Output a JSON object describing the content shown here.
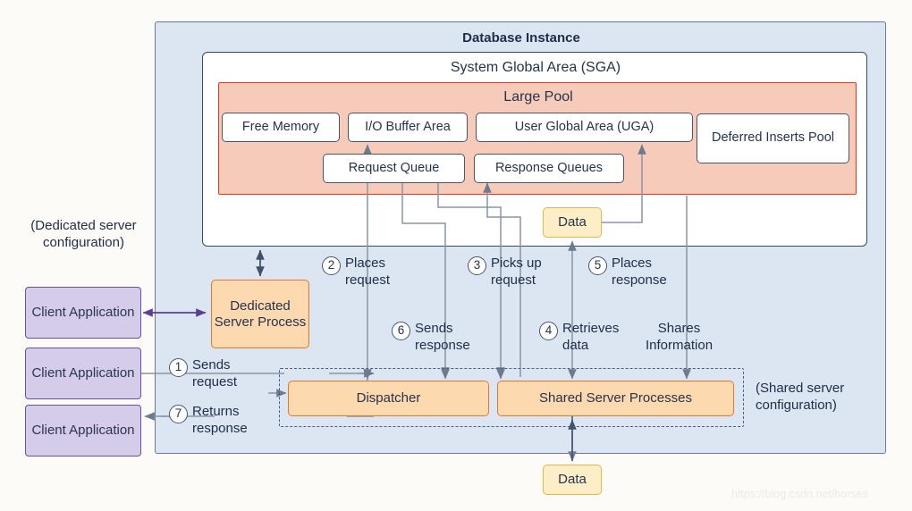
{
  "diagram": {
    "title": "Database Instance",
    "sga": {
      "title": "System Global Area (SGA)"
    },
    "large_pool": {
      "title": "Large Pool",
      "components": [
        {
          "id": "free-memory",
          "label": "Free Memory"
        },
        {
          "id": "io-buffer",
          "label": "I/O Buffer Area"
        },
        {
          "id": "uga",
          "label": "User Global Area (UGA)"
        },
        {
          "id": "deferred-inserts",
          "label": "Deferred Inserts Pool"
        },
        {
          "id": "request-queue",
          "label": "Request Queue"
        },
        {
          "id": "response-queues",
          "label": "Response Queues"
        }
      ]
    },
    "data_boxes": [
      {
        "id": "data-top",
        "label": "Data"
      },
      {
        "id": "data-bottom",
        "label": "Data"
      }
    ],
    "clients": [
      {
        "label": "Client Application"
      },
      {
        "label": "Client Application"
      },
      {
        "label": "Client Application"
      }
    ],
    "dedicated": {
      "config_label": "(Dedicated server configuration)",
      "process_label": "Dedicated Server Process"
    },
    "shared": {
      "config_label": "(Shared server configuration)",
      "dispatcher_label": "Dispatcher",
      "processes_label": "Shared Server Processes"
    },
    "steps": [
      {
        "num": "1",
        "text": "Sends\nrequest"
      },
      {
        "num": "2",
        "text": "Places\nrequest"
      },
      {
        "num": "3",
        "text": "Picks up\nrequest"
      },
      {
        "num": "4",
        "text": "Retrieves\ndata"
      },
      {
        "num": "5",
        "text": "Places\nresponse"
      },
      {
        "num": "6",
        "text": "Sends\nresponse"
      },
      {
        "num": "7",
        "text": "Returns\nresponse"
      },
      {
        "num": "",
        "text": "Shares\nInformation"
      }
    ],
    "watermark": "https://blog.csdn.net/horses",
    "colors": {
      "instance_fill": "#dce6f3",
      "instance_border": "#6b7a99",
      "sga_fill": "#ffffff",
      "sga_border": "#3b4a63",
      "large_pool_fill": "#f6cbb9",
      "large_pool_border": "#e23b23",
      "process_fill": "#fcd9ae",
      "process_border": "#e8772b",
      "client_fill": "#d4cce8",
      "client_border": "#6b4fa0",
      "data_fill": "#fdeec8",
      "data_border": "#e8b54a",
      "connector": "#8a94a6",
      "text": "#26334d"
    }
  }
}
